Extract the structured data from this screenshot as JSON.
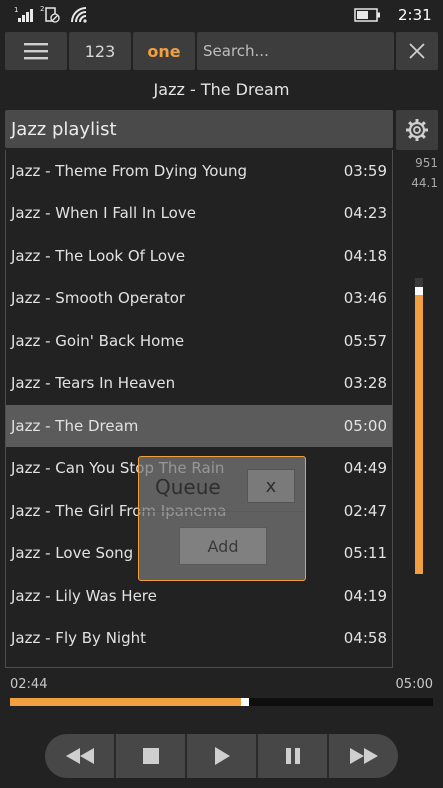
{
  "status": {
    "time": "2:31",
    "sim1": "1",
    "sim2": "2"
  },
  "toolbar": {
    "numbers_label": "123",
    "one_label": "one",
    "search_placeholder": "Search..."
  },
  "now_playing": {
    "title": "Jazz - The Dream",
    "elapsed": "02:44",
    "total": "05:00",
    "progress_fraction": 0.56
  },
  "playlist": {
    "title": "Jazz playlist",
    "tracks": [
      {
        "title": "Jazz - Theme From Dying Young",
        "duration": "03:59"
      },
      {
        "title": "Jazz - When I Fall In Love",
        "duration": "04:23"
      },
      {
        "title": "Jazz - The Look Of Love",
        "duration": "04:18"
      },
      {
        "title": "Jazz - Smooth Operator",
        "duration": "03:46"
      },
      {
        "title": "Jazz - Goin' Back Home",
        "duration": "05:57"
      },
      {
        "title": "Jazz - Tears In Heaven",
        "duration": "03:28"
      },
      {
        "title": "Jazz - The Dream",
        "duration": "05:00"
      },
      {
        "title": "Jazz - Can You Stop The Rain",
        "duration": "04:49"
      },
      {
        "title": "Jazz - The Girl From Ipanema",
        "duration": "02:47"
      },
      {
        "title": "Jazz - Love Song",
        "duration": "05:11"
      },
      {
        "title": "Jazz - Lily Was Here",
        "duration": "04:19"
      },
      {
        "title": "Jazz - Fly By Night",
        "duration": "04:58"
      }
    ],
    "selected_index": 6
  },
  "side_info": {
    "bitrate": "951",
    "samplerate": "44.1"
  },
  "volume": {
    "level_fraction": 0.97
  },
  "queue_popup": {
    "title": "Queue",
    "close_label": "x",
    "add_label": "Add"
  },
  "icons": {
    "menu": "hamburger-icon",
    "close": "close-icon",
    "settings": "gear-icon",
    "transport": [
      "rewind-icon",
      "stop-icon",
      "play-icon",
      "pause-icon",
      "fast-forward-icon"
    ]
  },
  "colors": {
    "accent": "#f0a040",
    "background": "#222222",
    "selected_row": "#5b5b5b"
  }
}
